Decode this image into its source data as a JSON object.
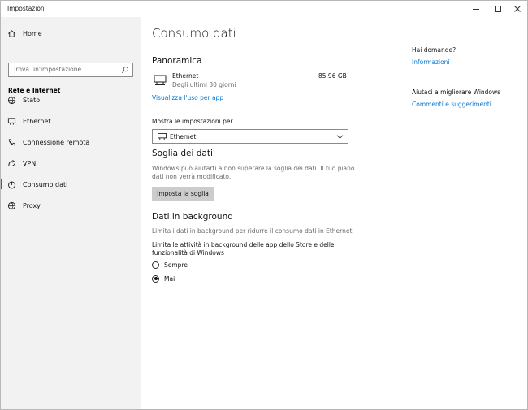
{
  "window": {
    "title": "Impostazioni",
    "controls": {
      "minimize": "—",
      "maximize": "☐",
      "close": "✕"
    }
  },
  "sidebar": {
    "home": "Home",
    "search_placeholder": "Trova un'impostazione",
    "section": "Rete e Internet",
    "items": [
      {
        "label": "Stato",
        "icon": "globe-status-icon"
      },
      {
        "label": "Ethernet",
        "icon": "ethernet-icon"
      },
      {
        "label": "Connessione remota",
        "icon": "phone-icon"
      },
      {
        "label": "VPN",
        "icon": "vpn-icon"
      },
      {
        "label": "Consumo dati",
        "icon": "data-usage-icon",
        "selected": true
      },
      {
        "label": "Proxy",
        "icon": "globe-icon"
      }
    ]
  },
  "main": {
    "title": "Consumo dati",
    "overview": {
      "heading": "Panoramica",
      "network": "Ethernet",
      "period": "Degli ultimi 30 giorni",
      "usage": "85.96 GB",
      "link": "Visualizza l'uso per app"
    },
    "show_settings": {
      "label": "Mostra le impostazioni per",
      "selected": "Ethernet"
    },
    "threshold": {
      "heading": "Soglia dei dati",
      "description_line1": "Windows può aiutarti a non superare la soglia dei dati. Il tuo piano",
      "description_line2": "dati non verrà modificato.",
      "button": "Imposta la soglia"
    },
    "background": {
      "heading": "Dati in background",
      "description": "Limita i dati in background per ridurre il consumo dati in Ethernet.",
      "question_line1": "Limita le attività in background delle app dello Store e delle",
      "question_line2": "funzionalità di Windows",
      "options": [
        {
          "label": "Sempre",
          "selected": false
        },
        {
          "label": "Mai",
          "selected": true
        }
      ]
    }
  },
  "aside": {
    "help_heading": "Hai domande?",
    "help_link": "Informazioni",
    "improve_heading": "Aiutaci a migliorare Windows",
    "improve_link": "Commenti e suggerimenti"
  },
  "colors": {
    "accent": "#0078d7",
    "sidebar_bg": "#f2f2f2",
    "button_bg": "#cccccc"
  }
}
